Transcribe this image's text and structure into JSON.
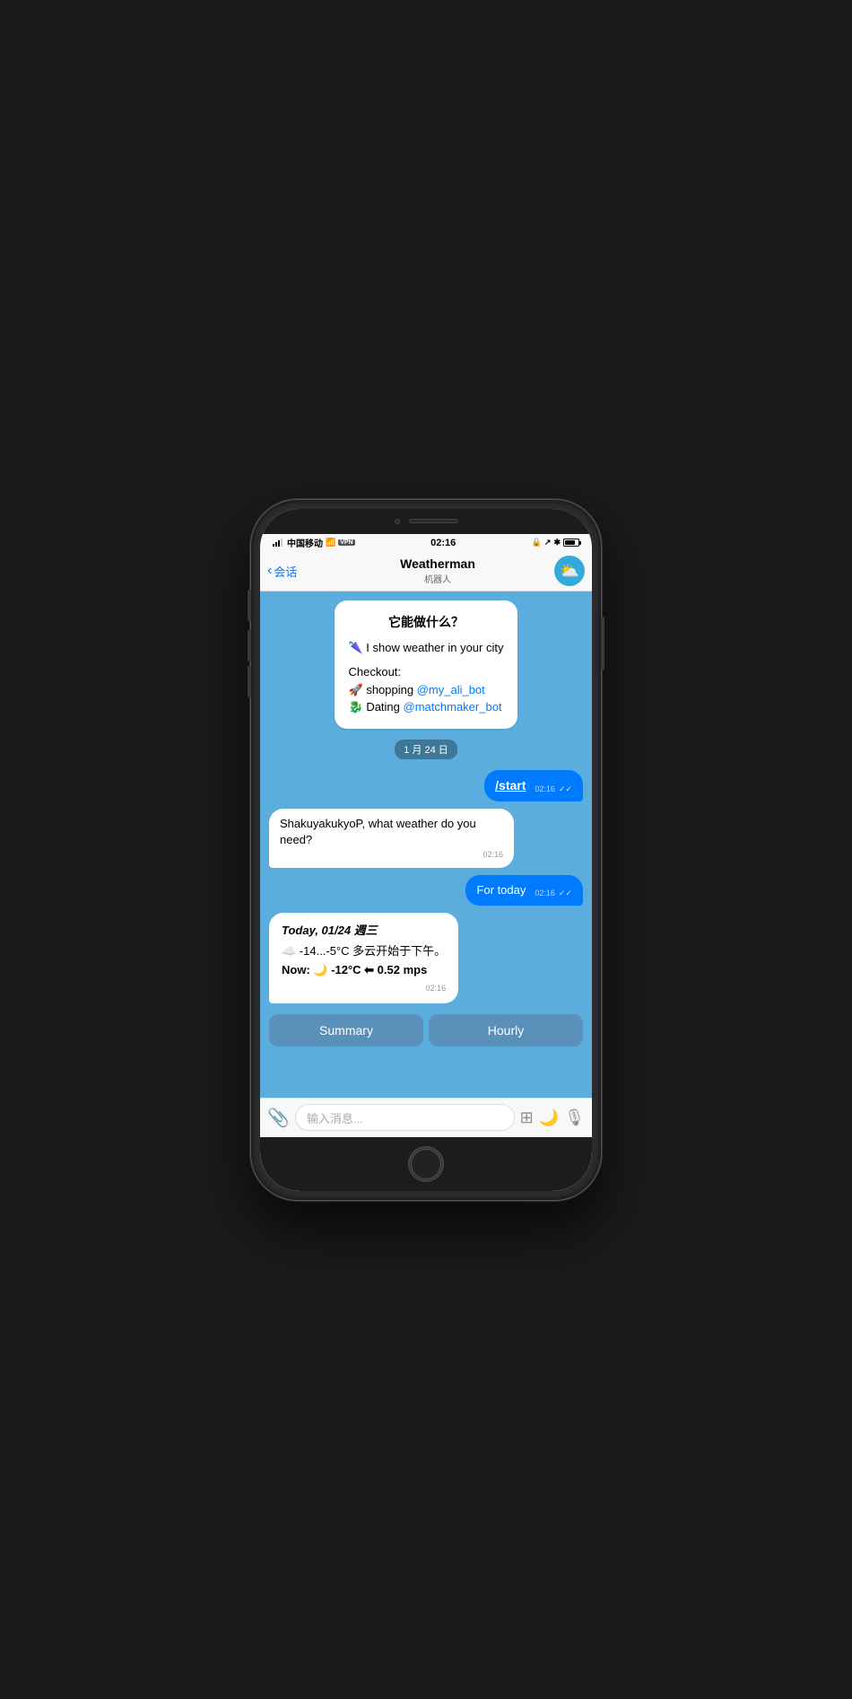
{
  "status_bar": {
    "carrier": "中国移动",
    "wifi": "📶",
    "vpn": "VPN",
    "time": "02:16",
    "battery": "100"
  },
  "nav": {
    "back_label": "会话",
    "title": "Weatherman",
    "subtitle": "机器人"
  },
  "welcome_bubble": {
    "title": "它能做什么？",
    "line1": "🌂 I show weather in your city",
    "checkout_label": "Checkout:",
    "link1_icon": "🚀",
    "link1_text": "shopping ",
    "link1_handle": "@my_ali_bot",
    "link2_icon": "🐉",
    "link2_text": "Dating ",
    "link2_handle": "@matchmaker_bot"
  },
  "date_separator": "1 月 24 日",
  "messages": [
    {
      "type": "outgoing",
      "text": "/start",
      "time": "02:16",
      "checks": "✓✓"
    },
    {
      "type": "incoming",
      "text": "ShakuyakukyoP, what weather do you need?",
      "time": "02:16"
    },
    {
      "type": "outgoing",
      "text": "For today",
      "time": "02:16",
      "checks": "✓✓"
    },
    {
      "type": "weather",
      "title": "Today, 01/24 週三",
      "temp_range": "☁️ -14...-5°C 多云开始于下午。",
      "now": "Now: 🌙 -12°C ⬅ 0.52 mps",
      "time": "02:16"
    }
  ],
  "action_buttons": {
    "summary": "Summary",
    "hourly": "Hourly"
  },
  "input_bar": {
    "placeholder": "输入消息..."
  }
}
